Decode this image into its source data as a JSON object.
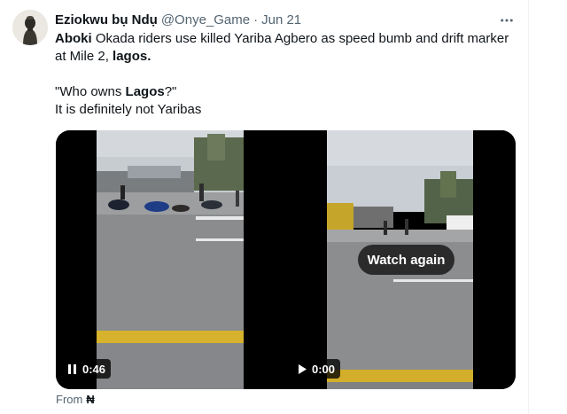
{
  "tweet": {
    "display_name": "Eziokwu bụ Ndụ",
    "handle": "@Onye_Game",
    "separator": "·",
    "date": "Jun 21",
    "text": {
      "line1_bold_1": "Aboki",
      "line1_regular": " Okada riders use killed Yariba Agbero as speed bumb and drift marker at Mile 2, ",
      "line1_bold_2": "lagos.",
      "line2_a": "\"Who owns ",
      "line2_bold": "Lagos",
      "line2_b": "?\"",
      "line3": "It is definitely not Yaribas"
    },
    "videos": [
      {
        "time": "0:46",
        "state": "paused",
        "control_icon": "pause-icon"
      },
      {
        "time": "0:00",
        "state": "ended",
        "control_icon": "play-icon",
        "overlay_label": "Watch again"
      }
    ],
    "source_prefix": "From",
    "source_name": "₦",
    "more_icon": "more-horizontal-icon"
  },
  "colors": {
    "text_primary": "#0f1419",
    "text_secondary": "#536471",
    "divider": "#eff3f4"
  }
}
